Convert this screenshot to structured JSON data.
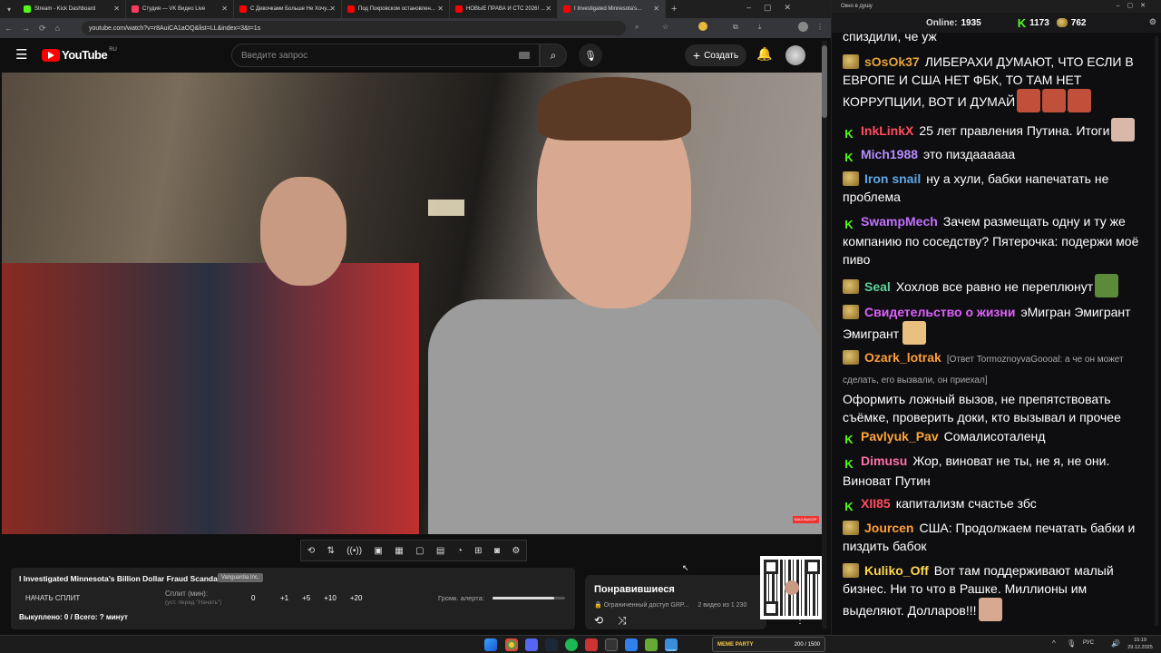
{
  "browser": {
    "tabs": [
      {
        "label": "Stream - Kick Dashboard",
        "color": "#53fc18"
      },
      {
        "label": "Студия — VK Видео Live",
        "color": "#ff3b5c"
      },
      {
        "label": "С Девочками Больше Не Хочу...",
        "color": "#ff0000"
      },
      {
        "label": "Под Покровском остановлен...",
        "color": "#ff0000"
      },
      {
        "label": "НОВЫЕ ПРАВА И СТС 2026! ...",
        "color": "#ff0000"
      },
      {
        "label": "I Investigated Minnesota's...",
        "color": "#ff0000"
      }
    ],
    "url": "youtube.com/watch?v=r8AuiCA1aOQ&list=LL&index=3&t=1s"
  },
  "youtube": {
    "logo_text": "YouTube",
    "region": "RU",
    "search_placeholder": "Введите запрос",
    "create_label": "Создать",
    "video_badge": "ВАШ ВЫБОР"
  },
  "split": {
    "title": "I Investigated Minnesota's Billion Dollar Fraud Scandal",
    "tag": "Vanguardia Inc.",
    "start_label": "НАЧАТЬ СПЛИТ",
    "split_label": "Сплит (мин):",
    "split_hint": "(уст. перед \"Начать\")",
    "split_value": "0",
    "increments": [
      "+1",
      "+5",
      "+10",
      "+20"
    ],
    "alert_label": "Громк. алерта:",
    "alert_volume": 0.85,
    "bought": "Выкуплено: 0 / Всего: ? минут"
  },
  "liked": {
    "title": "Понравившиеся",
    "access": "Ограниченный доступ",
    "owner": "GRP...",
    "progress": "2 видео из 1 230"
  },
  "chat": {
    "window_title": "Окно в душу",
    "online_label": "Online:",
    "online": "1935",
    "kick_count": "1173",
    "pepe_count": "762",
    "messages": [
      {
        "badge": "none",
        "nick": "",
        "nick_color": "#ffffff",
        "text": "спиздили, че уж"
      },
      {
        "badge": "p",
        "nick": "sOsOk37",
        "nick_color": "#e8a33a",
        "text": "ЛИБЕРАХИ ДУМАЮТ, ЧТО ЕСЛИ В ЕВРОПЕ И США НЕТ ФБК, ТО ТАМ НЕТ КОРРУПЦИИ, ВОТ И ДУМАЙ"
      },
      {
        "badge": "k",
        "nick": "InkLinkX",
        "nick_color": "#ff4d5e",
        "text": "25 лет правления Путина. Итоги"
      },
      {
        "badge": "k",
        "nick": "Mich1988",
        "nick_color": "#b58cff",
        "text": "это пиздаааааа"
      },
      {
        "badge": "p",
        "nick": "Iron snail",
        "nick_color": "#5fa8e8",
        "text": "ну а хули, бабки напечатать не проблема"
      },
      {
        "badge": "k",
        "nick": "SwampMech",
        "nick_color": "#c070ff",
        "text": "Зачем размещать одну и ту же компанию по соседству? Пятерочка: подержи моё пиво"
      },
      {
        "badge": "p",
        "nick": "Seal",
        "nick_color": "#5ed19a",
        "text": "Хохлов все равно не переплюнут"
      },
      {
        "badge": "p",
        "nick": "Свидетельство о жизни",
        "nick_color": "#e060ff",
        "text": "эМигран Эмигрант Эмигрант"
      },
      {
        "badge": "p",
        "nick": "Ozark_lotrak",
        "nick_color": "#ff9d3a",
        "reply": "[Ответ TormoznoyvaGoooal: а че он может сделать, его вызвали, он приехал]",
        "text": "Оформить ложный вызов, не препятствовать съёмке, проверить доки, кто вызывал и прочее"
      },
      {
        "badge": "k",
        "nick": "Pavlyuk_Pav",
        "nick_color": "#ffa53a",
        "text": "Сомалисоталенд"
      },
      {
        "badge": "k",
        "nick": "Dimusu",
        "nick_color": "#ff6fa8",
        "text": "Жор, виноват не ты, не я, не они. Виноват Путин"
      },
      {
        "badge": "k",
        "nick": "XII85",
        "nick_color": "#ff4d5e",
        "text": "капитализм счастье збс"
      },
      {
        "badge": "p",
        "nick": "Jourcen",
        "nick_color": "#ff9d3a",
        "text": "США: Продолжаем печатать бабки и пиздить бабок"
      },
      {
        "badge": "p",
        "nick": "Kuliko_Off",
        "nick_color": "#ffd84d",
        "text": "Вот там поддерживают малый бизнес. Ни то что в Рашке. Миллионы им выделяют. Долларов!!!"
      }
    ]
  },
  "taskbar": {
    "lang": "РУС",
    "time": "15:19",
    "date": "29.12.2025",
    "widget_label": "MEME PARTY",
    "widget_value": "200 / 1500"
  }
}
